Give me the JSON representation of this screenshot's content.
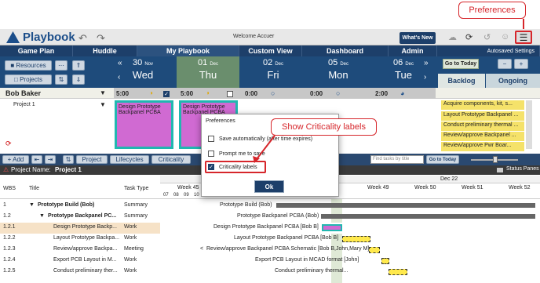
{
  "callouts": {
    "preferences": "Preferences",
    "criticality": "Show Criticality labels"
  },
  "app": {
    "name": "Playbook",
    "welcome": "Welcome Accuer",
    "whats_new": "What's New",
    "menu_icon": "hamburger-icon"
  },
  "nav": [
    "Game Plan",
    "Huddle",
    "My Playbook",
    "Custom View",
    "Dashboard",
    "Admin"
  ],
  "autosaved": "Autosaved Settings",
  "side": {
    "resources": "Resources",
    "projects": "Projects"
  },
  "days": [
    {
      "num": "30",
      "mon": "Nov",
      "wd": "Wed"
    },
    {
      "num": "01",
      "mon": "Dec",
      "wd": "Thu"
    },
    {
      "num": "02",
      "mon": "Dec",
      "wd": "Fri"
    },
    {
      "num": "05",
      "mon": "Dec",
      "wd": "Mon"
    },
    {
      "num": "06",
      "mon": "Dec",
      "wd": "Tue"
    }
  ],
  "go_to_today": "Go to Today",
  "tabs": {
    "backlog": "Backlog",
    "ongoing": "Ongoing"
  },
  "resource": {
    "name": "Bob Baker",
    "project": "Project 1",
    "hours": [
      "5:00",
      "5:00",
      "0:00",
      "0:00",
      "2:00"
    ]
  },
  "cards": [
    "Design Prototype Backpanel PCBA",
    "Design Prototype Backpanel PCBA"
  ],
  "backlog_items": [
    "Acquire components, kit, s...",
    "Layout Prototype Backpanel ...",
    "Conduct preliminary thermal ...",
    "Review/approve Backpanel ...",
    "Review/approve Pwr Boar..."
  ],
  "toolbar": {
    "add": "+ Add",
    "project": "Project",
    "lifecycles": "Lifecycles",
    "criticality": "Criticality",
    "search_ph": "Find tasks by title",
    "go_today": "Go to Today"
  },
  "project_name_label": "Project Name:",
  "project_name": "Project 1",
  "status_panes": "Status Panes",
  "grid": {
    "headers": [
      "WBS",
      "Title",
      "Task Type"
    ],
    "month": "Dec 22",
    "weeks": [
      "Week 45",
      "Week 49",
      "Week 50",
      "Week 51",
      "Week 52"
    ],
    "days": [
      "07",
      "08",
      "09",
      "10"
    ]
  },
  "rows": [
    {
      "wbs": "1",
      "title": "Prototype Build (Bob)",
      "type": "Summary",
      "label": "Prototype Build (Bob)"
    },
    {
      "wbs": "1.2",
      "title": "Prototype Backpanel PC...",
      "type": "Summary",
      "label": "Prototype Backpanel PCBA (Bob)"
    },
    {
      "wbs": "1.2.1",
      "title": "Design Prototype Backp...",
      "type": "Work",
      "label": "Design Prototype Backpanel PCBA [Bob B]"
    },
    {
      "wbs": "1.2.2",
      "title": "Layout Prototype Backpa...",
      "type": "Work",
      "label": "Layout Prototype Backpanel PCBA [Bob B]"
    },
    {
      "wbs": "1.2.3",
      "title": "Review/approve Backpa...",
      "type": "Meeting",
      "label": "Review/approve Backpanel PCBA Schematic [Bob B,John,Mary M]"
    },
    {
      "wbs": "1.2.4",
      "title": "Export PCB Layout in M...",
      "type": "Work",
      "label": "Export PCB Layout in MCAD format [John]"
    },
    {
      "wbs": "1.2.5",
      "title": "Conduct preliminary ther...",
      "type": "Work",
      "label": "Conduct preliminary thermal..."
    }
  ],
  "dialog": {
    "title": "Preferences",
    "options": [
      {
        "label": "Save automatically (after time expires)",
        "checked": false
      },
      {
        "label": "Prompt me to save",
        "checked": false
      },
      {
        "label": "Criticality labels",
        "checked": true
      }
    ],
    "ok": "Ok"
  }
}
